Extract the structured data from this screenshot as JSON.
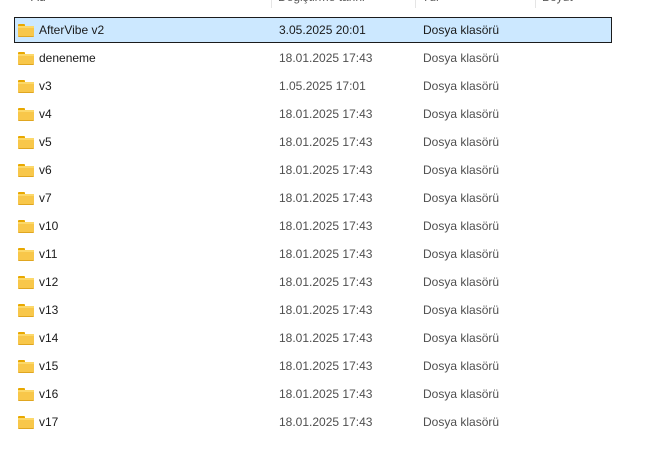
{
  "columns": {
    "name": "Ad",
    "date": "Değiştirme tarihi",
    "type": "Tür",
    "size": "Boyut"
  },
  "rows": [
    {
      "name": "AfterVibe v2",
      "date": "3.05.2025 20:01",
      "type": "Dosya klasörü",
      "selected": true
    },
    {
      "name": "deneneme",
      "date": "18.01.2025 17:43",
      "type": "Dosya klasörü"
    },
    {
      "name": "v3",
      "date": "1.05.2025 17:01",
      "type": "Dosya klasörü"
    },
    {
      "name": "v4",
      "date": "18.01.2025 17:43",
      "type": "Dosya klasörü"
    },
    {
      "name": "v5",
      "date": "18.01.2025 17:43",
      "type": "Dosya klasörü"
    },
    {
      "name": "v6",
      "date": "18.01.2025 17:43",
      "type": "Dosya klasörü"
    },
    {
      "name": "v7",
      "date": "18.01.2025 17:43",
      "type": "Dosya klasörü"
    },
    {
      "name": "v10",
      "date": "18.01.2025 17:43",
      "type": "Dosya klasörü"
    },
    {
      "name": "v11",
      "date": "18.01.2025 17:43",
      "type": "Dosya klasörü"
    },
    {
      "name": "v12",
      "date": "18.01.2025 17:43",
      "type": "Dosya klasörü"
    },
    {
      "name": "v13",
      "date": "18.01.2025 17:43",
      "type": "Dosya klasörü"
    },
    {
      "name": "v14",
      "date": "18.01.2025 17:43",
      "type": "Dosya klasörü"
    },
    {
      "name": "v15",
      "date": "18.01.2025 17:43",
      "type": "Dosya klasörü"
    },
    {
      "name": "v16",
      "date": "18.01.2025 17:43",
      "type": "Dosya klasörü"
    },
    {
      "name": "v17",
      "date": "18.01.2025 17:43",
      "type": "Dosya klasörü"
    }
  ],
  "icons": {
    "folder": "folder-icon"
  },
  "colors": {
    "selection_bg": "#cce8ff",
    "folder": "#f8c74a"
  }
}
